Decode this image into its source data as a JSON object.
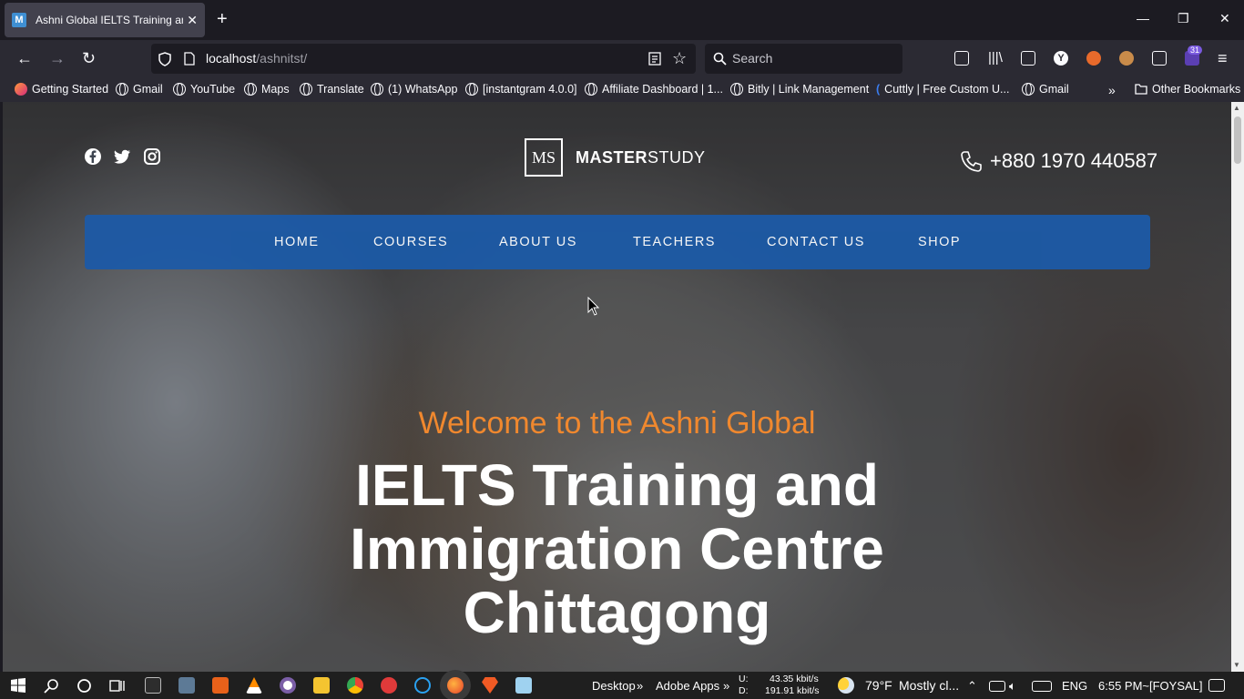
{
  "browser": {
    "tab": {
      "favicon": "M",
      "title": "Ashni Global IELTS Training and"
    },
    "url": {
      "host": "localhost",
      "path": "/ashnitst/"
    },
    "search_placeholder": "Search",
    "extension_badge": "31",
    "bookmarks": [
      "Getting Started",
      "Gmail",
      "YouTube",
      "Maps",
      "Translate",
      "(1) WhatsApp",
      "[instantgram 4.0.0]",
      "Affiliate Dashboard | 1...",
      "Bitly | Link Management",
      "Cuttly | Free Custom U...",
      "Gmail"
    ],
    "other_bookmarks": "Other Bookmarks"
  },
  "site": {
    "logo_mark": "MS",
    "logo_bold": "MASTER",
    "logo_light": "STUDY",
    "phone": "+880 1970 440587",
    "menu": [
      "HOME",
      "COURSES",
      "ABOUT US",
      "TEACHERS",
      "CONTACT US",
      "SHOP"
    ],
    "welcome": "Welcome to the Ashni Global",
    "headline": [
      "IELTS Training and",
      "Immigration Centre",
      "Chittagong"
    ],
    "colors": {
      "menu_bg": "#1c5aa6",
      "welcome": "#f0882e"
    }
  },
  "taskbar": {
    "desktop": "Desktop",
    "adobe": "Adobe Apps",
    "net_up_label": "U:",
    "net_up": "43.35 kbit/s",
    "net_down_label": "D:",
    "net_down": "191.91 kbit/s",
    "temp": "79°F",
    "weather": "Mostly cl...",
    "lang": "ENG",
    "clock": "6:55 PM~[FOYSAL]"
  }
}
